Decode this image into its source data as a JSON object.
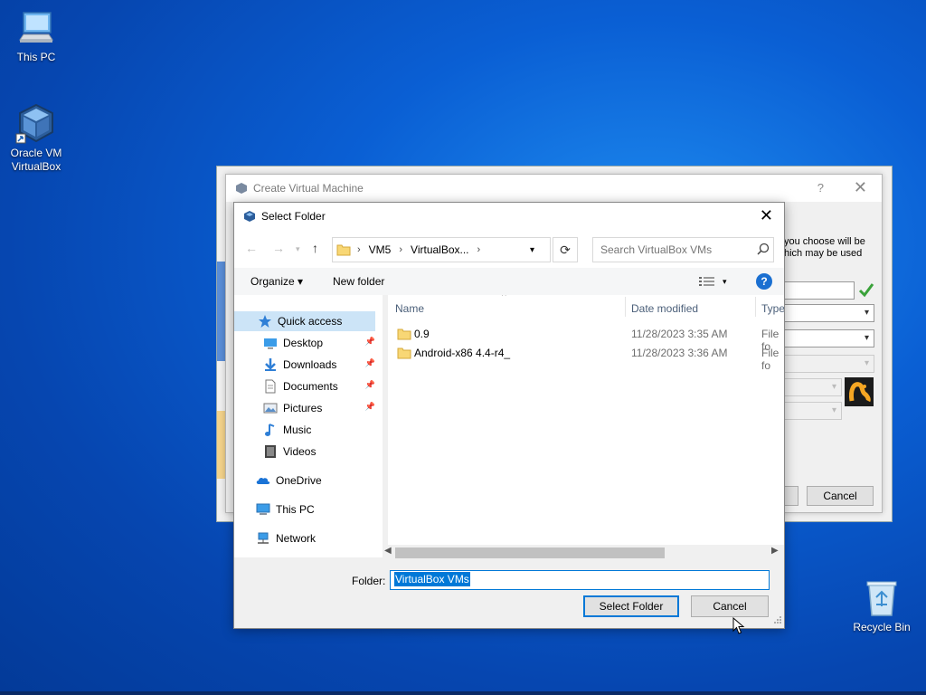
{
  "desktop": {
    "icons": [
      {
        "label": "This PC"
      },
      {
        "label_line1": "Oracle VM",
        "label_line2": "VirtualBox"
      },
      {
        "label": "Recycle Bin"
      }
    ]
  },
  "create_vm": {
    "title": "Create Virtual Machine",
    "help": "?",
    "close": "✕",
    "desc_line1": "you choose will be",
    "desc_line2": "hich may be used",
    "cancel_label": "Cancel"
  },
  "dialog": {
    "title": "Select Folder",
    "close": "✕",
    "address": {
      "segments": [
        "VM5",
        "VirtualBox..."
      ]
    },
    "search_placeholder": "Search VirtualBox VMs",
    "toolbar": {
      "organize": "Organize ▾",
      "new_folder": "New folder",
      "help": "?"
    },
    "nav": {
      "quick_access": "Quick access",
      "items": [
        {
          "label": "Desktop"
        },
        {
          "label": "Downloads"
        },
        {
          "label": "Documents"
        },
        {
          "label": "Pictures"
        },
        {
          "label": "Music"
        },
        {
          "label": "Videos"
        }
      ],
      "onedrive": "OneDrive",
      "this_pc": "This PC",
      "network": "Network"
    },
    "columns": {
      "name": "Name",
      "date": "Date modified",
      "type": "Type"
    },
    "rows": [
      {
        "name": "0.9",
        "date": "11/28/2023 3:35 AM",
        "type": "File fo"
      },
      {
        "name": "Android-x86 4.4-r4_",
        "date": "11/28/2023 3:36 AM",
        "type": "File fo"
      }
    ],
    "folder_label": "Folder:",
    "folder_value": "VirtualBox VMs",
    "select_label": "Select Folder",
    "cancel_label": "Cancel"
  }
}
